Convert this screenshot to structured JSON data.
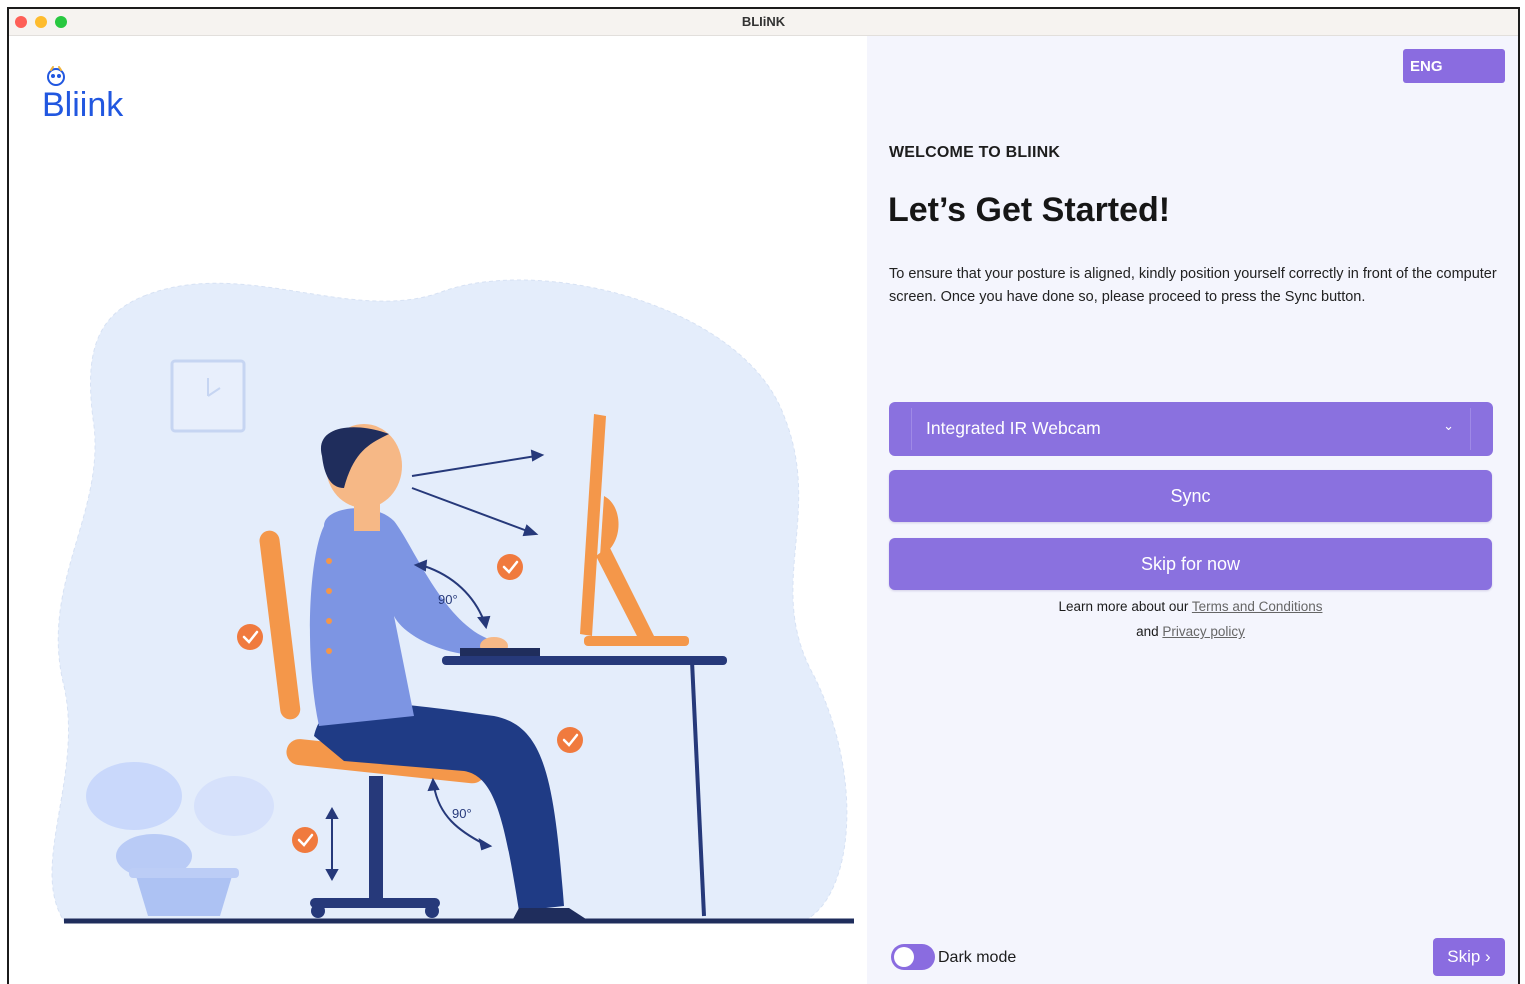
{
  "window": {
    "title": "BLIiNK"
  },
  "brand": {
    "logo_text": "Bliink",
    "accent": "#8a6ce0",
    "logo_blue": "#2157e0"
  },
  "illustration": {
    "angle_top": "90°",
    "angle_bottom": "90°"
  },
  "header": {
    "language_label": "ENG"
  },
  "main": {
    "welcome": "WELCOME TO BLIINK",
    "headline": "Let’s Get Started!",
    "description": "To ensure that your posture is aligned, kindly position yourself correctly in front of the computer screen. Once you have done so, please proceed to press the Sync button.",
    "camera_select": {
      "value": "Integrated IR Webcam",
      "icon": "chevron-down-icon"
    },
    "sync_label": "Sync",
    "skip_for_now_label": "Skip for now",
    "legal": {
      "prefix": "Learn more about our",
      "terms": "Terms and Conditions",
      "and": "and",
      "privacy": "Privacy policy"
    }
  },
  "footer": {
    "dark_mode_label": "Dark mode",
    "dark_mode_on": false,
    "skip_label": "Skip ›"
  }
}
